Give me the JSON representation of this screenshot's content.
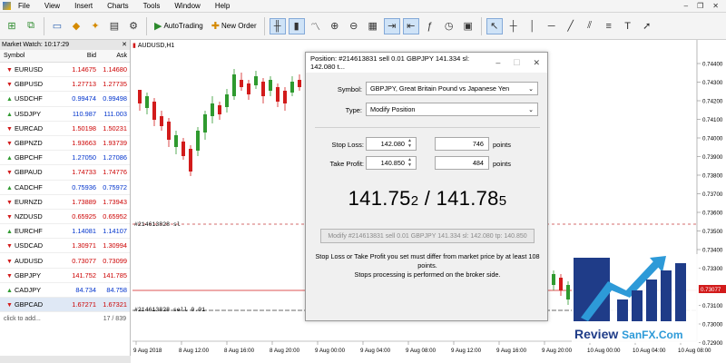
{
  "menu": {
    "items": [
      "File",
      "View",
      "Insert",
      "Charts",
      "Tools",
      "Window",
      "Help"
    ],
    "window_controls": [
      "–",
      "❐",
      "✕"
    ]
  },
  "toolbar": {
    "autotrading_label": "AutoTrading",
    "new_order_label": "New Order"
  },
  "market_watch": {
    "title": "Market Watch: 10:17:29",
    "headers": {
      "symbol": "Symbol",
      "bid": "Bid",
      "ask": "Ask"
    },
    "rows": [
      {
        "symbol": "EURUSD",
        "bid": "1.14675",
        "ask": "1.14680",
        "dir": "down"
      },
      {
        "symbol": "GBPUSD",
        "bid": "1.27713",
        "ask": "1.27735",
        "dir": "down"
      },
      {
        "symbol": "USDCHF",
        "bid": "0.99474",
        "ask": "0.99498",
        "dir": "up"
      },
      {
        "symbol": "USDJPY",
        "bid": "110.987",
        "ask": "111.003",
        "dir": "up"
      },
      {
        "symbol": "EURCAD",
        "bid": "1.50198",
        "ask": "1.50231",
        "dir": "down"
      },
      {
        "symbol": "GBPNZD",
        "bid": "1.93663",
        "ask": "1.93739",
        "dir": "down"
      },
      {
        "symbol": "GBPCHF",
        "bid": "1.27050",
        "ask": "1.27086",
        "dir": "up"
      },
      {
        "symbol": "GBPAUD",
        "bid": "1.74733",
        "ask": "1.74776",
        "dir": "down"
      },
      {
        "symbol": "CADCHF",
        "bid": "0.75936",
        "ask": "0.75972",
        "dir": "up"
      },
      {
        "symbol": "EURNZD",
        "bid": "1.73889",
        "ask": "1.73943",
        "dir": "down"
      },
      {
        "symbol": "NZDUSD",
        "bid": "0.65925",
        "ask": "0.65952",
        "dir": "down"
      },
      {
        "symbol": "EURCHF",
        "bid": "1.14081",
        "ask": "1.14107",
        "dir": "up"
      },
      {
        "symbol": "USDCAD",
        "bid": "1.30971",
        "ask": "1.30994",
        "dir": "down"
      },
      {
        "symbol": "AUDUSD",
        "bid": "0.73077",
        "ask": "0.73099",
        "dir": "down"
      },
      {
        "symbol": "GBPJPY",
        "bid": "141.752",
        "ask": "141.785",
        "dir": "down"
      },
      {
        "symbol": "CADJPY",
        "bid": "84.734",
        "ask": "84.758",
        "dir": "up"
      },
      {
        "symbol": "GBPCAD",
        "bid": "1.67271",
        "ask": "1.67321",
        "dir": "down"
      }
    ],
    "footer_add": "click to add...",
    "footer_count": "17 / 839"
  },
  "chart": {
    "tab_label": "AUDUSD,H1",
    "sl_label": "#214613828 sl",
    "order_label": "#214613828 sell 0.01",
    "price_axis": [
      "0.74400",
      "0.74300",
      "0.74200",
      "0.74100",
      "0.74000",
      "0.73900",
      "0.73800",
      "0.73700",
      "0.73600",
      "0.73500",
      "0.73400",
      "0.73300",
      "0.73200",
      "0.73100",
      "0.73000",
      "0.72900"
    ],
    "highlight_price": "0.73077",
    "time_axis": [
      "9 Aug 2018",
      "8 Aug 12:00",
      "8 Aug 16:00",
      "8 Aug 20:00",
      "9 Aug 00:00",
      "9 Aug 04:00",
      "9 Aug 08:00",
      "9 Aug 12:00",
      "9 Aug 16:00",
      "9 Aug 20:00",
      "10 Aug 00:00",
      "10 Aug 04:00",
      "10 Aug 08:00"
    ],
    "colors": {
      "bull": "#2f9a2f",
      "bear": "#d21b1b",
      "sl_line": "#c83c3c",
      "order_line": "#3a3a3a",
      "price_line": "#d21b1b"
    }
  },
  "dialog": {
    "title": "Position: #214613831 sell 0.01 GBPJPY 141.334 sl: 142.080 t...",
    "symbol_label": "Symbol:",
    "symbol_value": "GBPJPY, Great Britain Pound vs Japanese Yen",
    "type_label": "Type:",
    "type_value": "Modify Position",
    "stop_loss_label": "Stop Loss:",
    "stop_loss_value": "142.080",
    "stop_loss_points": "746",
    "take_profit_label": "Take Profit:",
    "take_profit_value": "140.850",
    "take_profit_points": "484",
    "points_label": "points",
    "bid_main": "141.75",
    "bid_small": "2",
    "sep": " / ",
    "ask_main": "141.78",
    "ask_small": "5",
    "modify_button": "Modify #214613831 sell 0.01 GBPJPY 141.334 sl: 142.080 tp: 140.850",
    "note_line1": "Stop Loss or Take Profit you set must differ from market price by at least 108 points.",
    "note_line2": "Stops processing is performed on the broker side."
  },
  "watermark": {
    "brand_a": "Review ",
    "brand_b": "SanFX",
    "brand_c": ".Com"
  }
}
